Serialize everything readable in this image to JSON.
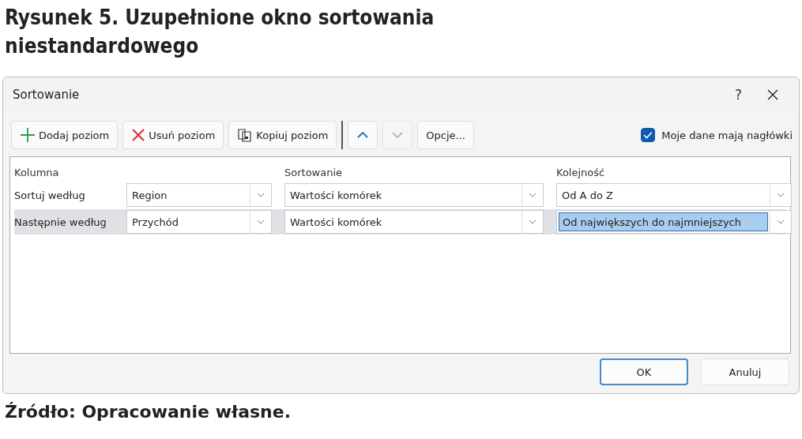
{
  "caption": {
    "title": "Rysunek 5. Uzupełnione okno sortowania niestandardowego",
    "source": "Źródło: Opracowanie własne."
  },
  "window": {
    "title": "Sortowanie",
    "help": "?"
  },
  "toolbar": {
    "buttons": [
      {
        "kind": "add",
        "label": "Dodaj poziom",
        "disabled": false
      },
      {
        "kind": "delete",
        "label": "Usuń poziom",
        "disabled": false
      },
      {
        "kind": "copy",
        "label": "Kopiuj poziom",
        "disabled": false
      },
      {
        "kind": "up",
        "disabled": false
      },
      {
        "kind": "down",
        "disabled": true
      },
      {
        "kind": "text",
        "label": "Opcje...",
        "disabled": false
      }
    ],
    "headers_checkbox": {
      "label": "Moje dane mają nagłówki",
      "checked": true
    }
  },
  "table": {
    "columns": [
      "Kolumna",
      "Sortowanie",
      "Kolejność"
    ],
    "rows": [
      {
        "label": "Sortuj według",
        "column": "Region",
        "sort_on": "Wartości komórek",
        "order": "Od A do Z",
        "selected": false
      },
      {
        "label": "Następnie według",
        "column": "Przychód",
        "sort_on": "Wartości komórek",
        "order": "Od największych do najmniejszych",
        "selected": true
      }
    ]
  },
  "buttons": [
    {
      "label": "OK",
      "default": true
    },
    {
      "label": "Anuluj",
      "default": false
    }
  ]
}
